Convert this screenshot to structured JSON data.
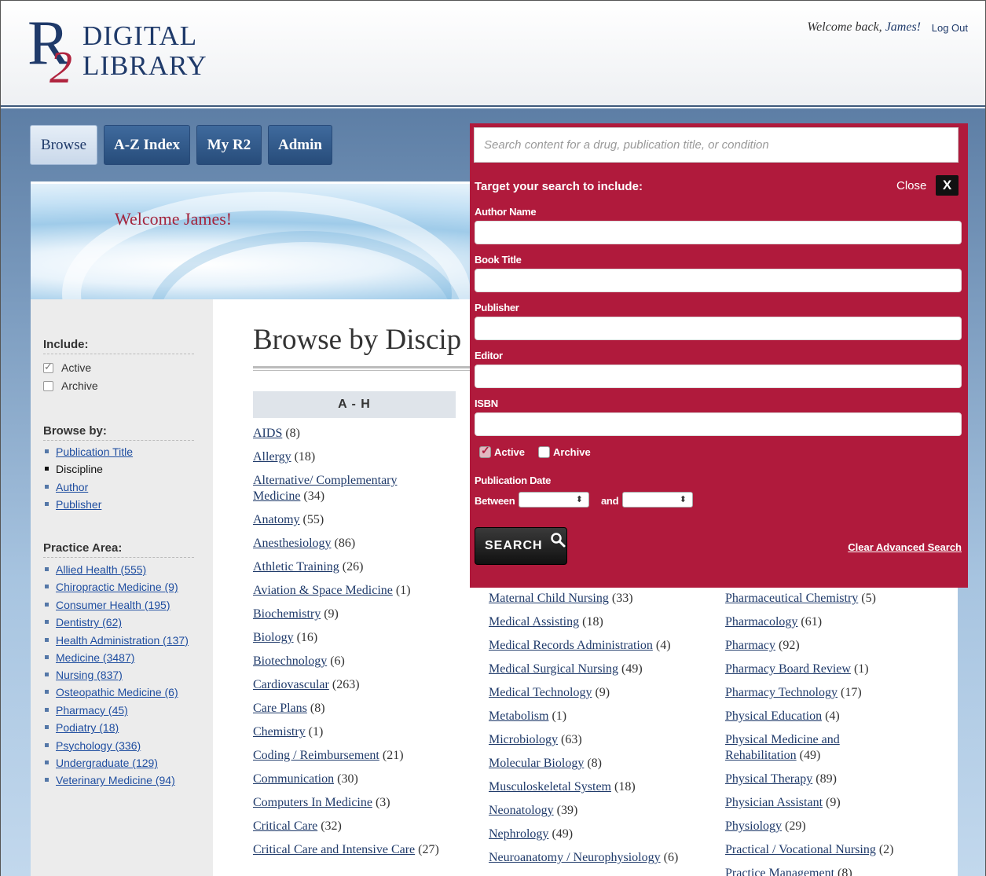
{
  "header": {
    "logo_letter": "R",
    "logo_two": "2",
    "logo_line1": "DIGITAL",
    "logo_line2": "LIBRARY",
    "welcome_prefix": "Welcome back, ",
    "welcome_name": "James!",
    "logout": "Log Out"
  },
  "nav": {
    "tabs": [
      {
        "label": "Browse"
      },
      {
        "label": "A-Z Index"
      },
      {
        "label": "My R2"
      },
      {
        "label": "Admin"
      }
    ]
  },
  "banner": {
    "title": "Welcome James!"
  },
  "sidebar": {
    "include_heading": "Include:",
    "include": [
      {
        "label": "Active",
        "checked": true
      },
      {
        "label": "Archive",
        "checked": false
      }
    ],
    "browse_heading": "Browse by:",
    "browse_by": [
      {
        "label": "Publication Title"
      },
      {
        "label": "Discipline"
      },
      {
        "label": "Author"
      },
      {
        "label": "Publisher"
      }
    ],
    "practice_heading": "Practice Area:",
    "practice_areas": [
      {
        "label": "Allied Health (555)"
      },
      {
        "label": "Chiropractic Medicine (9)"
      },
      {
        "label": "Consumer Health (195)"
      },
      {
        "label": "Dentistry (62)"
      },
      {
        "label": "Health Administration (137)"
      },
      {
        "label": "Medicine (3487)"
      },
      {
        "label": "Nursing (837)"
      },
      {
        "label": "Osteopathic Medicine (6)"
      },
      {
        "label": "Pharmacy (45)"
      },
      {
        "label": "Podiatry (18)"
      },
      {
        "label": "Psychology (336)"
      },
      {
        "label": "Undergraduate (129)"
      },
      {
        "label": "Veterinary Medicine (94)"
      }
    ]
  },
  "main": {
    "title": "Browse by Discip",
    "column_a_heading": "A - H",
    "column_a": [
      {
        "name": "AIDS",
        "count": "(8)"
      },
      {
        "name": "Allergy",
        "count": "(18)"
      },
      {
        "name": "Alternative/ Complementary Medicine",
        "count": "(34)"
      },
      {
        "name": "Anatomy",
        "count": "(55)"
      },
      {
        "name": "Anesthesiology",
        "count": "(86)"
      },
      {
        "name": "Athletic Training",
        "count": "(26)"
      },
      {
        "name": "Aviation & Space Medicine",
        "count": "(1)"
      },
      {
        "name": "Biochemistry",
        "count": "(9)"
      },
      {
        "name": "Biology",
        "count": "(16)"
      },
      {
        "name": "Biotechnology",
        "count": "(6)"
      },
      {
        "name": "Cardiovascular",
        "count": "(263)"
      },
      {
        "name": "Care Plans",
        "count": "(8)"
      },
      {
        "name": "Chemistry",
        "count": "(1)"
      },
      {
        "name": "Coding / Reimbursement",
        "count": "(21)"
      },
      {
        "name": "Communication",
        "count": "(30)"
      },
      {
        "name": "Computers In Medicine",
        "count": "(3)"
      },
      {
        "name": "Critical Care",
        "count": "(32)"
      },
      {
        "name": "Critical Care and Intensive Care",
        "count": "(27)"
      }
    ],
    "column_b": [
      {
        "name": "Maternal Child Nursing",
        "count": "(33)"
      },
      {
        "name": "Medical Assisting",
        "count": "(18)"
      },
      {
        "name": "Medical Records Administration",
        "count": "(4)"
      },
      {
        "name": "Medical Surgical Nursing",
        "count": "(49)"
      },
      {
        "name": "Medical Technology",
        "count": "(9)"
      },
      {
        "name": "Metabolism",
        "count": "(1)"
      },
      {
        "name": "Microbiology",
        "count": "(63)"
      },
      {
        "name": "Molecular Biology",
        "count": "(8)"
      },
      {
        "name": "Musculoskeletal System",
        "count": "(18)"
      },
      {
        "name": "Neonatology",
        "count": "(39)"
      },
      {
        "name": "Nephrology",
        "count": "(49)"
      },
      {
        "name": "Neuroanatomy / Neurophysiology",
        "count": "(6)"
      }
    ],
    "column_c": [
      {
        "name": "Pharmaceutical Chemistry",
        "count": "(5)"
      },
      {
        "name": "Pharmacology",
        "count": "(61)"
      },
      {
        "name": "Pharmacy",
        "count": "(92)"
      },
      {
        "name": "Pharmacy Board Review",
        "count": "(1)"
      },
      {
        "name": "Pharmacy Technology",
        "count": "(17)"
      },
      {
        "name": "Physical Education",
        "count": "(4)"
      },
      {
        "name": "Physical Medicine and Rehabilitation",
        "count": "(49)"
      },
      {
        "name": "Physical Therapy",
        "count": "(89)"
      },
      {
        "name": "Physician Assistant",
        "count": "(9)"
      },
      {
        "name": "Physiology",
        "count": "(29)"
      },
      {
        "name": "Practical / Vocational Nursing",
        "count": "(2)"
      },
      {
        "name": "Practice Management",
        "count": "(8)"
      }
    ]
  },
  "advanced_search": {
    "search_placeholder": "Search content for a drug, publication title, or condition",
    "target_label": "Target your search to include:",
    "close_label": "Close",
    "close_icon": "X",
    "fields": [
      {
        "label": "Author Name"
      },
      {
        "label": "Book Title"
      },
      {
        "label": "Publisher"
      },
      {
        "label": "Editor"
      },
      {
        "label": "ISBN"
      }
    ],
    "active_label": "Active",
    "active_checked": true,
    "archive_label": "Archive",
    "archive_checked": false,
    "pub_date_label": "Publication Date",
    "between_label": "Between",
    "and_label": "and",
    "search_button": "SEARCH",
    "clear_label": "Clear Advanced Search"
  },
  "colors": {
    "brand_navy": "#1f3a6a",
    "brand_red": "#b01a3c",
    "link": "#1f4ea0"
  }
}
